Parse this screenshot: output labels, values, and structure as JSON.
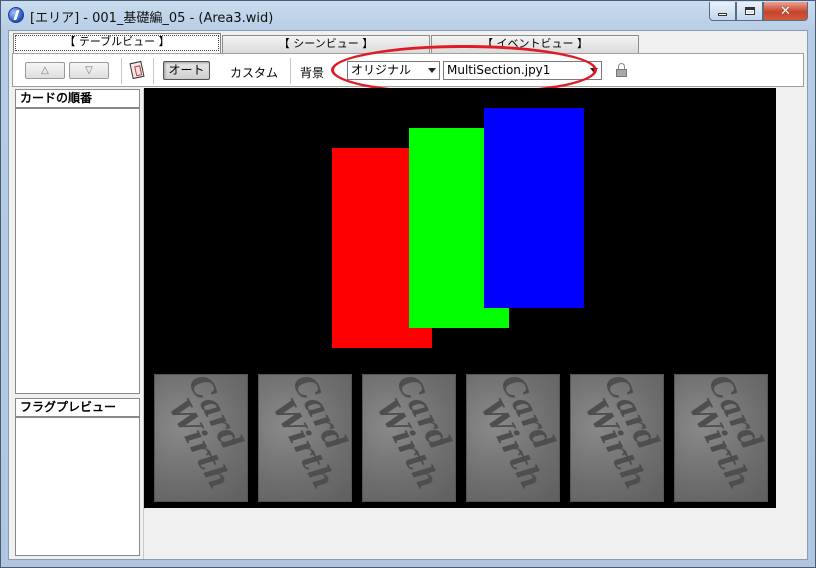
{
  "window": {
    "title": "[エリア] - 001_基礎編_05 - (Area3.wid)"
  },
  "tabs": [
    {
      "label": "【 テーブルビュー 】",
      "active": true
    },
    {
      "label": "【 シーンビュー 】",
      "active": false
    },
    {
      "label": "【 イベントビュー 】",
      "active": false
    }
  ],
  "toolbar": {
    "up_label": "△",
    "down_label": "▽",
    "auto_label": "オート",
    "custom_label": "カスタム",
    "background_label": "背景",
    "bg_mode": "オリジナル",
    "bg_image": "MultiSection.jpy1"
  },
  "panels": {
    "card_order_title": "カードの順番",
    "flag_preview_title": "フラグプレビュー"
  },
  "stage": {
    "rect_colors": [
      "#ff0000",
      "#00ff00",
      "#0000ff"
    ],
    "card_count": 6,
    "card_text_line1": "Card",
    "card_text_line2": "Wirth"
  },
  "colors": {
    "annotation": "#e01b24",
    "stage_bg": "#000000"
  }
}
